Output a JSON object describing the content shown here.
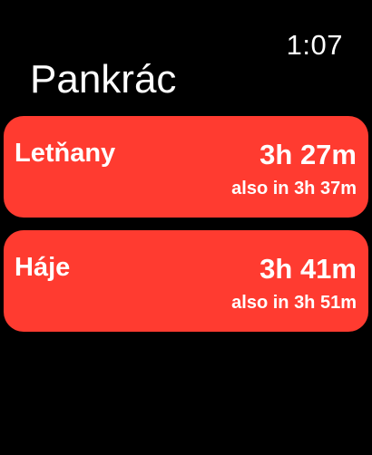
{
  "status": {
    "time": "1:07"
  },
  "header": {
    "title": "Pankrác"
  },
  "colors": {
    "row_bg": "#ff3b30",
    "background": "#000000",
    "text": "#ffffff"
  },
  "departures": [
    {
      "destination": "Letňany",
      "time": "3h 27m",
      "also": "also in 3h 37m"
    },
    {
      "destination": "Háje",
      "time": "3h 41m",
      "also": "also in 3h 51m"
    }
  ]
}
